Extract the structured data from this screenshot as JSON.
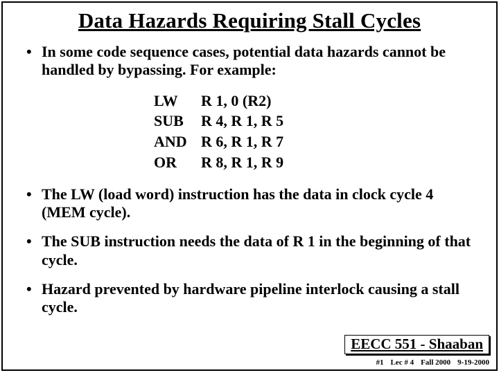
{
  "title": "Data Hazards Requiring Stall Cycles",
  "bullets": {
    "b0": "In some code sequence cases,  potential data hazards cannot be handled by bypassing.   For example:",
    "b1": "The LW (load word) instruction has the data in clock cycle 4 (MEM cycle).",
    "b2": "The SUB instruction needs the data of R 1 in the beginning of that cycle.",
    "b3": "Hazard prevented by hardware pipeline interlock causing a stall cycle."
  },
  "code": [
    {
      "mnemonic": "LW",
      "ops": "R 1, 0 (R2)"
    },
    {
      "mnemonic": "SUB",
      "ops": "R 4, R 1, R 5"
    },
    {
      "mnemonic": "AND",
      "ops": " R 6, R 1, R 7"
    },
    {
      "mnemonic": "OR",
      "ops": " R 8, R 1, R 9"
    }
  ],
  "footer": {
    "course": "EECC 551 - Shaaban",
    "page": "#1",
    "lecture": "Lec # 4",
    "term": "Fall 2000",
    "date": "9-19-2000"
  }
}
